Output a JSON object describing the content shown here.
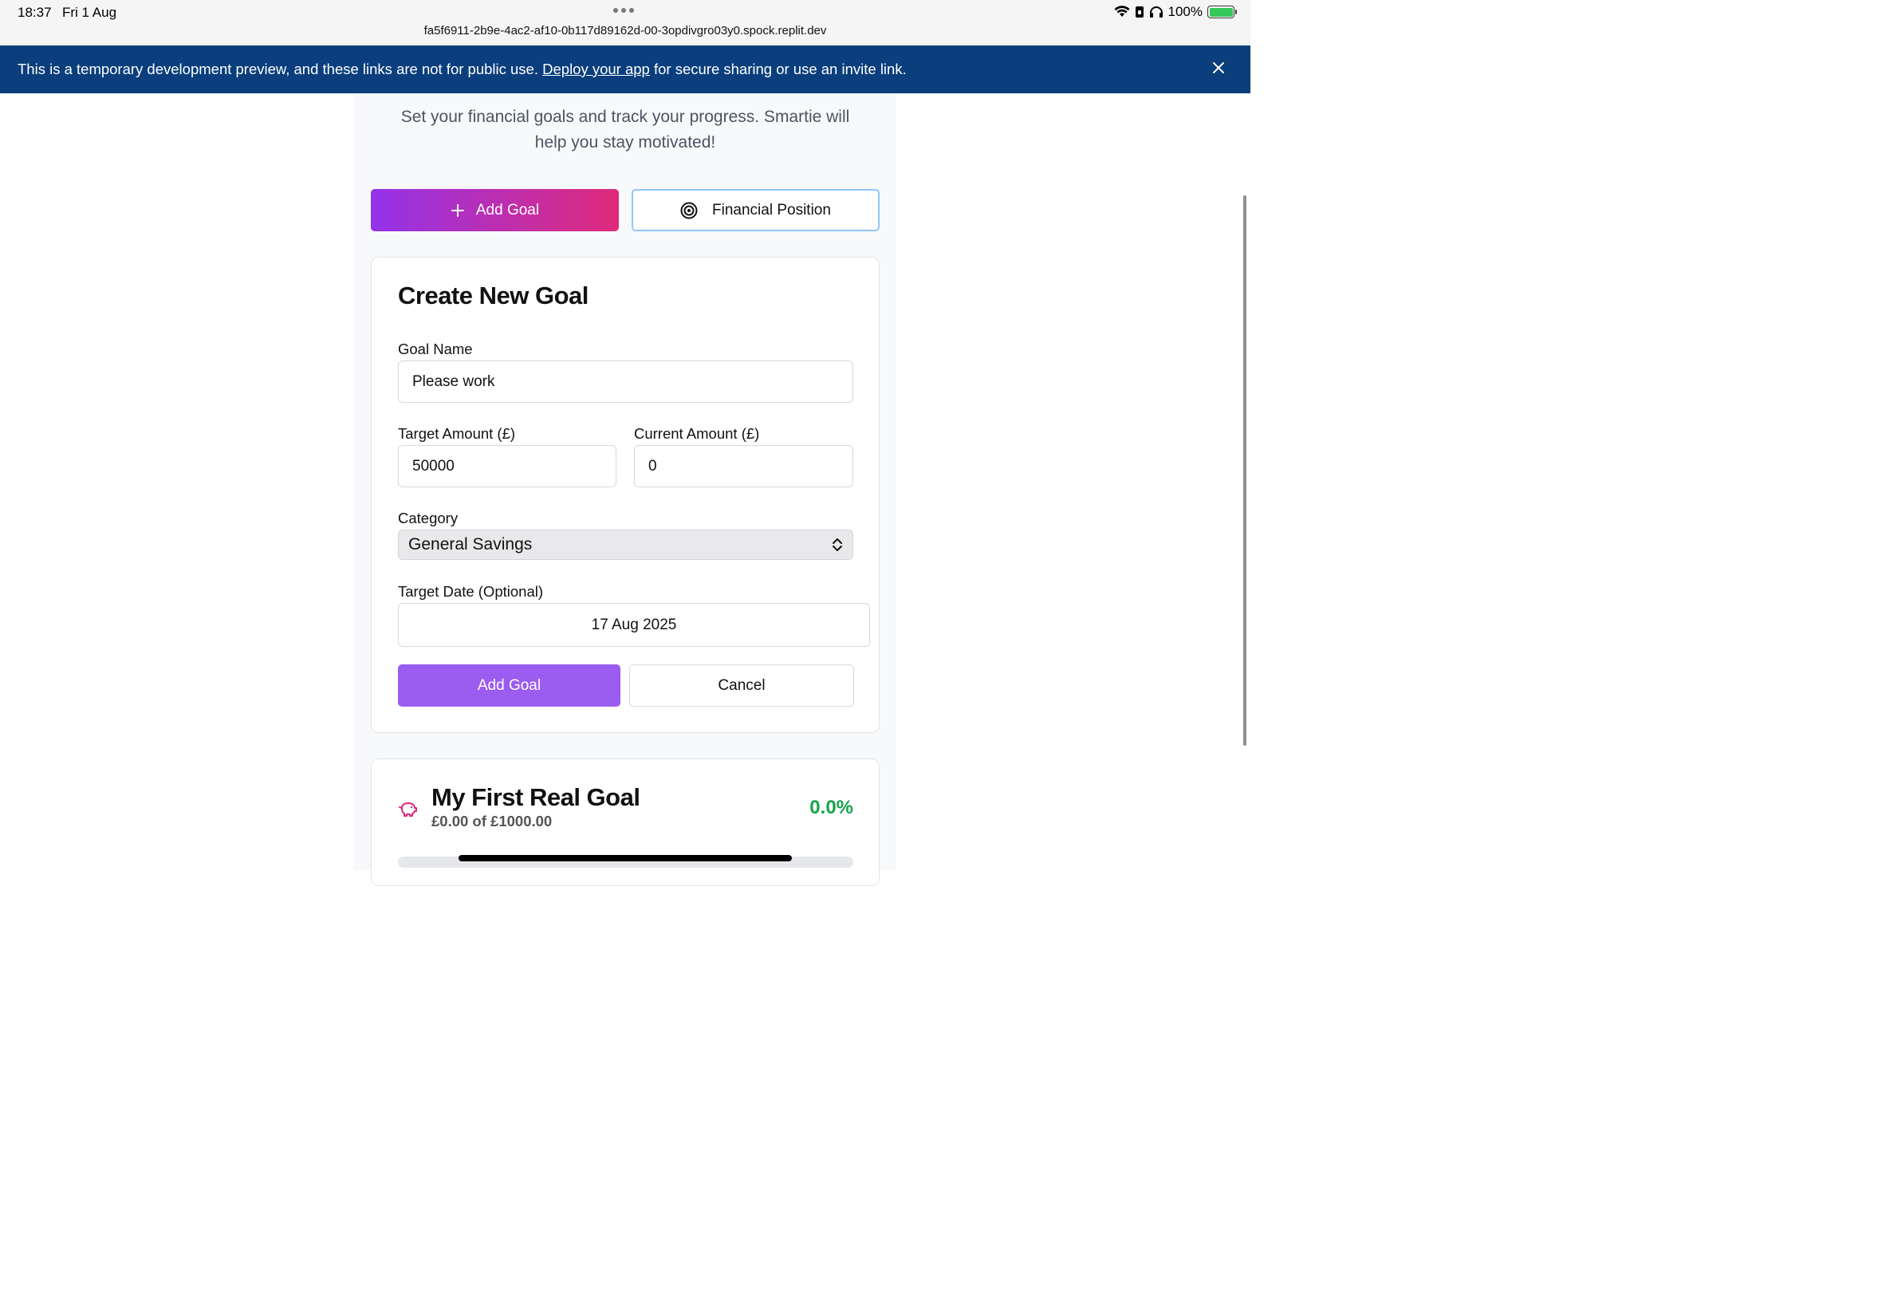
{
  "status": {
    "time": "18:37",
    "date": "Fri 1 Aug",
    "url": "fa5f6911-2b9e-4ac2-af10-0b117d89162d-00-3opdivgro03y0.spock.replit.dev",
    "battery": "100%"
  },
  "banner": {
    "text_before": "This is a temporary development preview, and these links are not for public use. ",
    "link": "Deploy your app",
    "text_after": " for secure sharing or use an invite link."
  },
  "intro": {
    "line1": "Set your financial goals and track your progress. Smartie will",
    "line2": "help you stay motivated!"
  },
  "actions": {
    "add_goal": "Add Goal",
    "financial_position": "Financial Position"
  },
  "form": {
    "title": "Create New Goal",
    "goal_name_label": "Goal Name",
    "goal_name_value": "Please work",
    "target_amount_label": "Target Amount (£)",
    "target_amount_value": "50000",
    "current_amount_label": "Current Amount (£)",
    "current_amount_value": "0",
    "category_label": "Category",
    "category_value": "General Savings",
    "target_date_label": "Target Date (Optional)",
    "target_date_value": "17 Aug 2025",
    "submit": "Add Goal",
    "cancel": "Cancel"
  },
  "goal": {
    "title": "My First Real Goal",
    "amount": "£0.00 of £1000.00",
    "percent": "0.0%",
    "progress": 0.0
  },
  "colors": {
    "banner": "#0a3e7c",
    "gradient_start": "#9333ea",
    "gradient_end": "#e02a7a",
    "submit": "#9b5cf0",
    "success": "#16a34a",
    "goal_icon": "#db2777"
  },
  "icons": [
    "plus-icon",
    "target-icon",
    "close-icon",
    "chevron-updown-icon",
    "piggy-bank-icon",
    "wifi-icon",
    "lock-icon",
    "headphones-icon",
    "battery-icon"
  ]
}
